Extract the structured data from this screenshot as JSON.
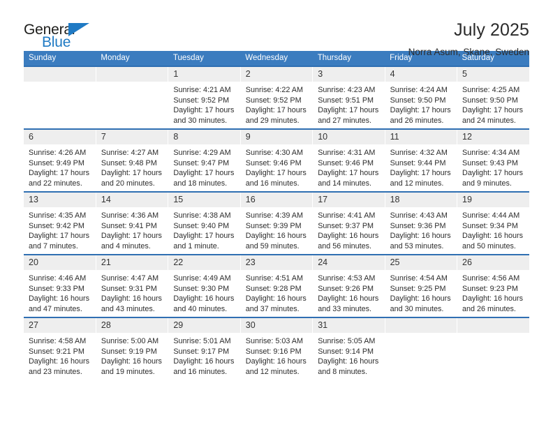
{
  "brand": {
    "name_primary": "General",
    "name_secondary": "Blue",
    "accent_color": "#1f7ac4"
  },
  "header": {
    "title": "July 2025",
    "subtitle": "Norra Asum, Skane, Sweden"
  },
  "calendar": {
    "header_bg": "#3b7cbf",
    "daynum_bg": "#eeeeee",
    "weekday_headers": [
      "Sunday",
      "Monday",
      "Tuesday",
      "Wednesday",
      "Thursday",
      "Friday",
      "Saturday"
    ],
    "weeks": [
      [
        {
          "day": "",
          "blank": true
        },
        {
          "day": "",
          "blank": true
        },
        {
          "day": "1",
          "sunrise": "Sunrise: 4:21 AM",
          "sunset": "Sunset: 9:52 PM",
          "daylight": "Daylight: 17 hours and 30 minutes."
        },
        {
          "day": "2",
          "sunrise": "Sunrise: 4:22 AM",
          "sunset": "Sunset: 9:52 PM",
          "daylight": "Daylight: 17 hours and 29 minutes."
        },
        {
          "day": "3",
          "sunrise": "Sunrise: 4:23 AM",
          "sunset": "Sunset: 9:51 PM",
          "daylight": "Daylight: 17 hours and 27 minutes."
        },
        {
          "day": "4",
          "sunrise": "Sunrise: 4:24 AM",
          "sunset": "Sunset: 9:50 PM",
          "daylight": "Daylight: 17 hours and 26 minutes."
        },
        {
          "day": "5",
          "sunrise": "Sunrise: 4:25 AM",
          "sunset": "Sunset: 9:50 PM",
          "daylight": "Daylight: 17 hours and 24 minutes."
        }
      ],
      [
        {
          "day": "6",
          "sunrise": "Sunrise: 4:26 AM",
          "sunset": "Sunset: 9:49 PM",
          "daylight": "Daylight: 17 hours and 22 minutes."
        },
        {
          "day": "7",
          "sunrise": "Sunrise: 4:27 AM",
          "sunset": "Sunset: 9:48 PM",
          "daylight": "Daylight: 17 hours and 20 minutes."
        },
        {
          "day": "8",
          "sunrise": "Sunrise: 4:29 AM",
          "sunset": "Sunset: 9:47 PM",
          "daylight": "Daylight: 17 hours and 18 minutes."
        },
        {
          "day": "9",
          "sunrise": "Sunrise: 4:30 AM",
          "sunset": "Sunset: 9:46 PM",
          "daylight": "Daylight: 17 hours and 16 minutes."
        },
        {
          "day": "10",
          "sunrise": "Sunrise: 4:31 AM",
          "sunset": "Sunset: 9:46 PM",
          "daylight": "Daylight: 17 hours and 14 minutes."
        },
        {
          "day": "11",
          "sunrise": "Sunrise: 4:32 AM",
          "sunset": "Sunset: 9:44 PM",
          "daylight": "Daylight: 17 hours and 12 minutes."
        },
        {
          "day": "12",
          "sunrise": "Sunrise: 4:34 AM",
          "sunset": "Sunset: 9:43 PM",
          "daylight": "Daylight: 17 hours and 9 minutes."
        }
      ],
      [
        {
          "day": "13",
          "sunrise": "Sunrise: 4:35 AM",
          "sunset": "Sunset: 9:42 PM",
          "daylight": "Daylight: 17 hours and 7 minutes."
        },
        {
          "day": "14",
          "sunrise": "Sunrise: 4:36 AM",
          "sunset": "Sunset: 9:41 PM",
          "daylight": "Daylight: 17 hours and 4 minutes."
        },
        {
          "day": "15",
          "sunrise": "Sunrise: 4:38 AM",
          "sunset": "Sunset: 9:40 PM",
          "daylight": "Daylight: 17 hours and 1 minute."
        },
        {
          "day": "16",
          "sunrise": "Sunrise: 4:39 AM",
          "sunset": "Sunset: 9:39 PM",
          "daylight": "Daylight: 16 hours and 59 minutes."
        },
        {
          "day": "17",
          "sunrise": "Sunrise: 4:41 AM",
          "sunset": "Sunset: 9:37 PM",
          "daylight": "Daylight: 16 hours and 56 minutes."
        },
        {
          "day": "18",
          "sunrise": "Sunrise: 4:43 AM",
          "sunset": "Sunset: 9:36 PM",
          "daylight": "Daylight: 16 hours and 53 minutes."
        },
        {
          "day": "19",
          "sunrise": "Sunrise: 4:44 AM",
          "sunset": "Sunset: 9:34 PM",
          "daylight": "Daylight: 16 hours and 50 minutes."
        }
      ],
      [
        {
          "day": "20",
          "sunrise": "Sunrise: 4:46 AM",
          "sunset": "Sunset: 9:33 PM",
          "daylight": "Daylight: 16 hours and 47 minutes."
        },
        {
          "day": "21",
          "sunrise": "Sunrise: 4:47 AM",
          "sunset": "Sunset: 9:31 PM",
          "daylight": "Daylight: 16 hours and 43 minutes."
        },
        {
          "day": "22",
          "sunrise": "Sunrise: 4:49 AM",
          "sunset": "Sunset: 9:30 PM",
          "daylight": "Daylight: 16 hours and 40 minutes."
        },
        {
          "day": "23",
          "sunrise": "Sunrise: 4:51 AM",
          "sunset": "Sunset: 9:28 PM",
          "daylight": "Daylight: 16 hours and 37 minutes."
        },
        {
          "day": "24",
          "sunrise": "Sunrise: 4:53 AM",
          "sunset": "Sunset: 9:26 PM",
          "daylight": "Daylight: 16 hours and 33 minutes."
        },
        {
          "day": "25",
          "sunrise": "Sunrise: 4:54 AM",
          "sunset": "Sunset: 9:25 PM",
          "daylight": "Daylight: 16 hours and 30 minutes."
        },
        {
          "day": "26",
          "sunrise": "Sunrise: 4:56 AM",
          "sunset": "Sunset: 9:23 PM",
          "daylight": "Daylight: 16 hours and 26 minutes."
        }
      ],
      [
        {
          "day": "27",
          "sunrise": "Sunrise: 4:58 AM",
          "sunset": "Sunset: 9:21 PM",
          "daylight": "Daylight: 16 hours and 23 minutes."
        },
        {
          "day": "28",
          "sunrise": "Sunrise: 5:00 AM",
          "sunset": "Sunset: 9:19 PM",
          "daylight": "Daylight: 16 hours and 19 minutes."
        },
        {
          "day": "29",
          "sunrise": "Sunrise: 5:01 AM",
          "sunset": "Sunset: 9:17 PM",
          "daylight": "Daylight: 16 hours and 16 minutes."
        },
        {
          "day": "30",
          "sunrise": "Sunrise: 5:03 AM",
          "sunset": "Sunset: 9:16 PM",
          "daylight": "Daylight: 16 hours and 12 minutes."
        },
        {
          "day": "31",
          "sunrise": "Sunrise: 5:05 AM",
          "sunset": "Sunset: 9:14 PM",
          "daylight": "Daylight: 16 hours and 8 minutes."
        },
        {
          "day": "",
          "blank": true
        },
        {
          "day": "",
          "blank": true
        }
      ]
    ]
  }
}
